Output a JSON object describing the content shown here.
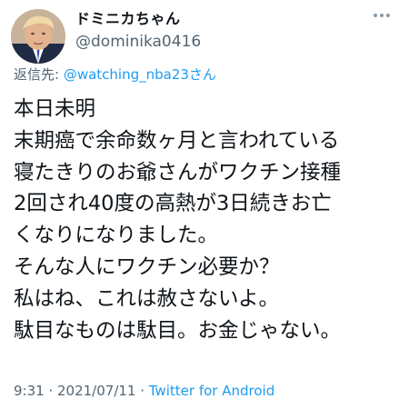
{
  "author": {
    "display_name": "ドミニカちゃん",
    "handle": "@dominika0416"
  },
  "reply": {
    "prefix": "返信先: ",
    "to_handle": "@watching_nba23さん"
  },
  "tweet": {
    "lines": [
      "本日未明",
      "末期癌で余命数ヶ月と言われている",
      "寝たきりのお爺さんがワクチン接種",
      "2回され40度の高熱が3日続きお亡",
      "くなりになりました。",
      "そんな人にワクチン必要か？",
      "私はね、これは赦さないよ。",
      "駄目なものは駄目。お金じゃない。"
    ]
  },
  "meta": {
    "time": "9:31",
    "separator_1": " · ",
    "date": "2021/07/11",
    "separator_2": " · ",
    "client": "Twitter for Android"
  },
  "colors": {
    "text": "#0f1419",
    "secondary": "#536471",
    "link": "#1d9bf0",
    "background": "#ffffff"
  },
  "icons": {
    "avatar": "avatar-photo",
    "more": "more-options-icon"
  }
}
